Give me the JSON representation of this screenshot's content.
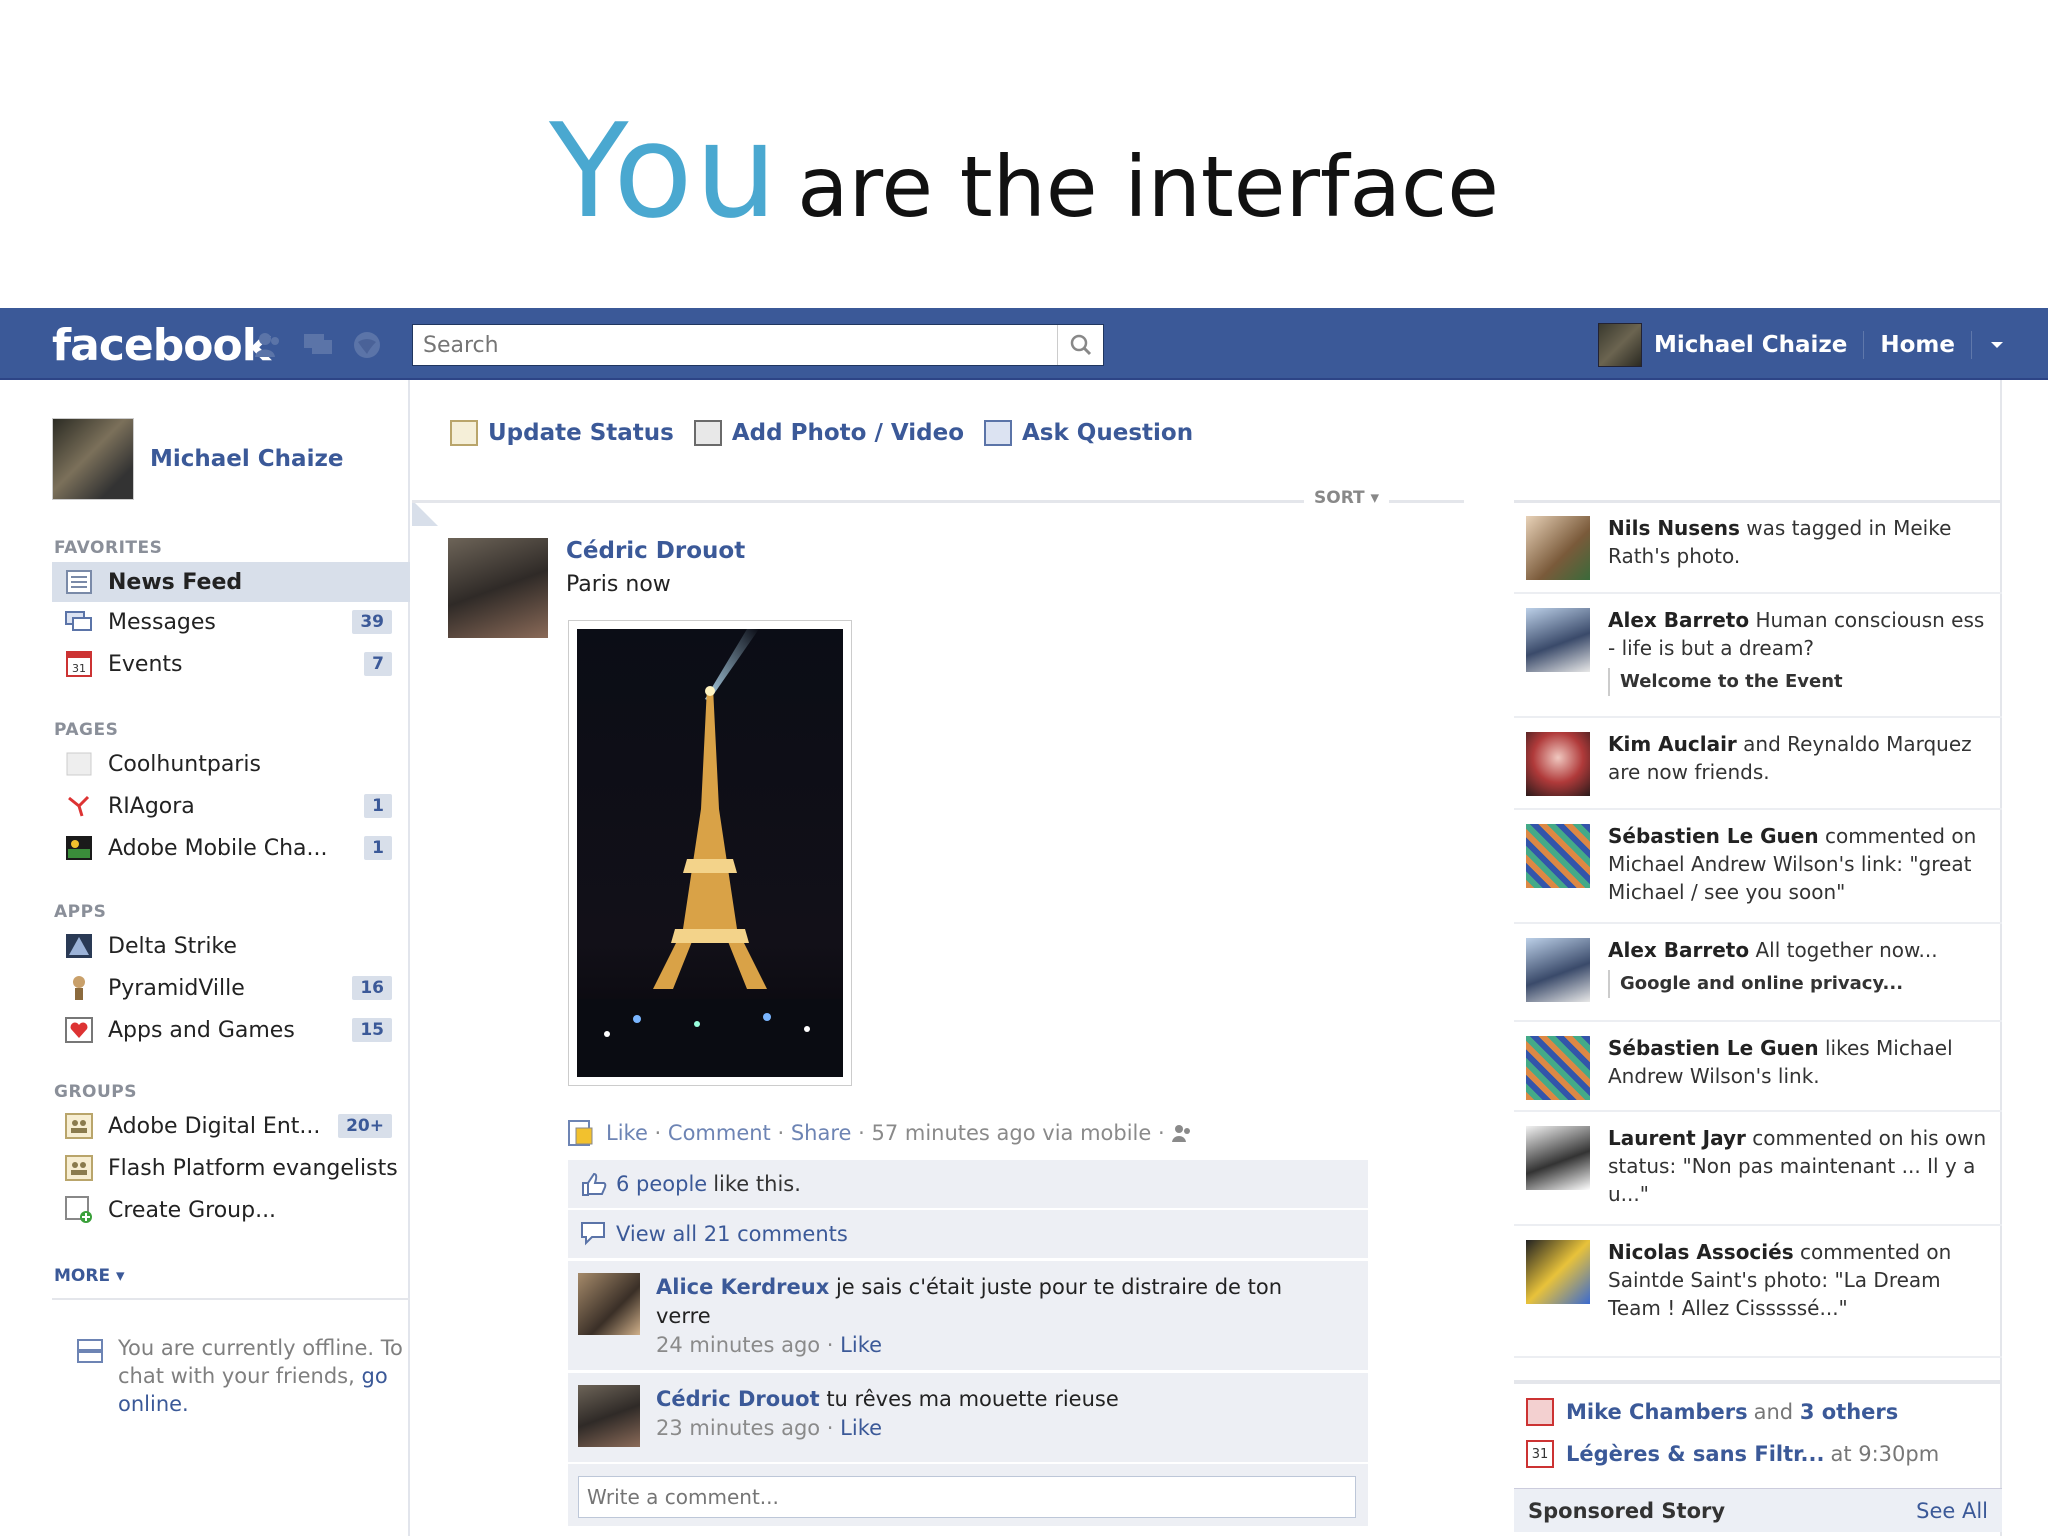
{
  "slide": {
    "title_you": "You",
    "title_rest": "are the interface"
  },
  "topbar": {
    "logo": "facebook",
    "search_placeholder": "Search",
    "user_name": "Michael Chaize",
    "home_label": "Home",
    "jewels": [
      "friend-requests-icon",
      "messages-icon",
      "notifications-icon"
    ]
  },
  "sidebar": {
    "profile_name": "Michael Chaize",
    "favorites_title": "FAVORITES",
    "favorites": [
      {
        "label": "News Feed",
        "count": ""
      },
      {
        "label": "Messages",
        "count": "39"
      },
      {
        "label": "Events",
        "count": "7"
      }
    ],
    "pages_title": "PAGES",
    "pages": [
      {
        "label": "Coolhuntparis",
        "count": ""
      },
      {
        "label": "RIAgora",
        "count": "1"
      },
      {
        "label": "Adobe Mobile Cha...",
        "count": "1"
      }
    ],
    "apps_title": "APPS",
    "apps": [
      {
        "label": "Delta Strike",
        "count": ""
      },
      {
        "label": "PyramidVille",
        "count": "16"
      },
      {
        "label": "Apps and Games",
        "count": "15"
      }
    ],
    "groups_title": "GROUPS",
    "groups": [
      {
        "label": "Adobe Digital Ent...",
        "count": "20+"
      },
      {
        "label": "Flash Platform evangelists",
        "count": ""
      },
      {
        "label": "Create Group...",
        "count": ""
      }
    ],
    "more_label": "MORE",
    "offline_text": "You are currently offline. To chat with your friends,",
    "go_online": "go online."
  },
  "composer": {
    "update_status": "Update Status",
    "add_photo": "Add Photo / Video",
    "ask_question": "Ask Question",
    "sort_label": "SORT"
  },
  "post": {
    "author": "Cédric Drouot",
    "text": "Paris now",
    "like": "Like",
    "comment": "Comment",
    "share": "Share",
    "time": "57 minutes ago via mobile",
    "likes_count": "6 people",
    "likes_suffix": "like this.",
    "view_all": "View all 21 comments",
    "comments": [
      {
        "name": "Alice Kerdreux",
        "text": "je sais c'était juste pour te distraire de ton verre",
        "time": "24 minutes ago",
        "like": "Like"
      },
      {
        "name": "Cédric Drouot",
        "text": "tu rêves ma mouette rieuse",
        "time": "23 minutes ago",
        "like": "Like"
      }
    ],
    "write_placeholder": "Write a comment..."
  },
  "ticker": [
    {
      "name": "Nils Nusens",
      "text": "was tagged in Meike Rath's photo.",
      "sub": ""
    },
    {
      "name": "Alex Barreto",
      "text": "Human consciousn ess - life is but a dream?",
      "sub": "Welcome to the Event"
    },
    {
      "name": "Kim Auclair",
      "text": "and Reynaldo Marquez are now friends.",
      "sub": ""
    },
    {
      "name": "Sébastien Le Guen",
      "text": "commented on Michael Andrew Wilson's link: \"great Michael / see you soon\"",
      "sub": ""
    },
    {
      "name": "Alex Barreto",
      "text": "All together now...",
      "sub": "Google and online privacy..."
    },
    {
      "name": "Sébastien Le Guen",
      "text": "likes Michael Andrew Wilson's link.",
      "sub": ""
    },
    {
      "name": "Laurent Jayr",
      "text": "commented on his own status: \"Non pas maintenant ... Il y a u...\"",
      "sub": ""
    },
    {
      "name": "Nicolas Associés",
      "text": "commented on Saintde Saint's photo: \"La Dream Team ! Allez Cisssssé...\"",
      "sub": ""
    }
  ],
  "events": {
    "birthday_name": "Mike Chambers",
    "birthday_rest": "and",
    "birthday_others": "3 others",
    "event_name": "Légères & sans Filtr...",
    "event_time": "at 9:30pm",
    "calendar_day": "31"
  },
  "sponsored": {
    "label": "Sponsored Story",
    "see_all": "See All"
  },
  "colors": {
    "brand": "#3b5998",
    "accent": "#4aa8d0",
    "badge_bg": "#d8dfea"
  }
}
